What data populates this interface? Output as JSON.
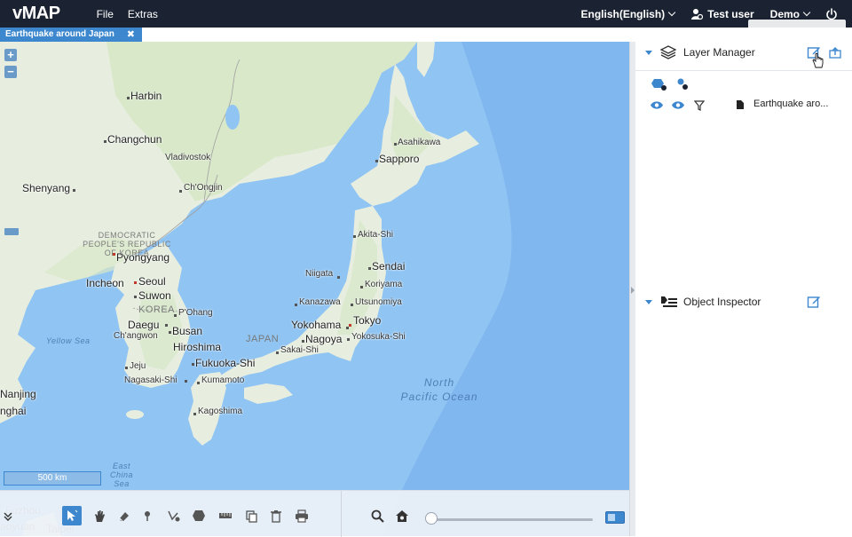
{
  "app": {
    "logo": "vMAP",
    "menu": [
      {
        "label": "File"
      },
      {
        "label": "Extras"
      }
    ],
    "language": "English(English)",
    "user": "Test user",
    "project": "Demo"
  },
  "tab": {
    "label": "Earthquake around Japan",
    "close": "✖"
  },
  "map": {
    "zoom_in": "+",
    "zoom_out": "−",
    "scale": "500 km",
    "cities": [
      {
        "name": "Harbin",
        "size": "large"
      },
      {
        "name": "Changchun",
        "size": "large"
      },
      {
        "name": "Vladivostok",
        "size": "small"
      },
      {
        "name": "Shenyang",
        "size": "large"
      },
      {
        "name": "Ch'Ongjin",
        "size": "small"
      },
      {
        "name": "Pyongyang",
        "size": "large"
      },
      {
        "name": "Incheon",
        "size": "large"
      },
      {
        "name": "Seoul",
        "size": "large"
      },
      {
        "name": "Suwon",
        "size": "large"
      },
      {
        "name": "P'Ohang",
        "size": "small"
      },
      {
        "name": "Daegu",
        "size": "large"
      },
      {
        "name": "Busan",
        "size": "large"
      },
      {
        "name": "Ch'angwon",
        "size": "small"
      },
      {
        "name": "Hiroshima",
        "size": "large"
      },
      {
        "name": "Fukuoka-Shi",
        "size": "large"
      },
      {
        "name": "Jeju",
        "size": "small"
      },
      {
        "name": "Nagasaki-Shi",
        "size": "small"
      },
      {
        "name": "Kumamoto",
        "size": "small"
      },
      {
        "name": "Kagoshima",
        "size": "small"
      },
      {
        "name": "Asahikawa",
        "size": "small"
      },
      {
        "name": "Sapporo",
        "size": "large"
      },
      {
        "name": "Akita-Shi",
        "size": "small"
      },
      {
        "name": "Sendai",
        "size": "large"
      },
      {
        "name": "Niigata",
        "size": "small"
      },
      {
        "name": "Koriyama",
        "size": "small"
      },
      {
        "name": "Kanazawa",
        "size": "small"
      },
      {
        "name": "Utsunomiya",
        "size": "small"
      },
      {
        "name": "Tokyo",
        "size": "large"
      },
      {
        "name": "Yokohama",
        "size": "large"
      },
      {
        "name": "Nagoya",
        "size": "large"
      },
      {
        "name": "Yokosuka-Shi",
        "size": "small"
      },
      {
        "name": "Sakai-Shi",
        "size": "small"
      },
      {
        "name": "Nanjing",
        "size": "large"
      },
      {
        "name": "nghai",
        "size": "large"
      },
      {
        "name": "Fuzhou",
        "size": "large"
      },
      {
        "name": "aoyuan",
        "size": "large"
      },
      {
        "name": "Taipei",
        "size": "large"
      }
    ],
    "regions": {
      "dprk": "DEMOCRATIC PEOPLE'S REPUBLIC OF KOREA",
      "korea": "KOREA",
      "japan": "JAPAN"
    },
    "seas": {
      "yellow": "Yellow Sea",
      "pacific_line1": "North",
      "pacific_line2": "Pacific Ocean",
      "east_china_1": "East",
      "east_china_2": "China",
      "east_china_3": "Sea"
    }
  },
  "panel": {
    "layer_manager": "Layer Manager",
    "object_inspector": "Object Inspector",
    "layer_name": "Earthquake aro..."
  },
  "colors": {
    "topbar": "#1b2333",
    "accent": "#3d87cf",
    "water": "#8fc4f3",
    "land": "#e9efe3"
  }
}
